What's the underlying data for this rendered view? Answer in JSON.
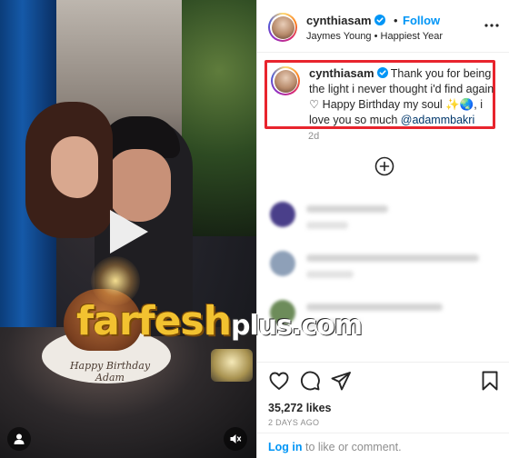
{
  "media": {
    "plate_text": "Happy Birthday Adam",
    "icons": [
      "play-icon",
      "person-tag-icon",
      "mute-icon"
    ]
  },
  "header": {
    "username": "cynthiasam",
    "separator": "•",
    "follow_label": "Follow",
    "subtitle": "Jaymes Young • Happiest Year",
    "more_icon": "more-icon"
  },
  "caption": {
    "username": "cynthiasam",
    "text": "Thank you for being the light i never thought i'd find again ♡ Happy Birthday my soul ✨🌏, i love you so much",
    "mention": "@adammbakri",
    "age": "2d"
  },
  "blurred_comments": [
    {
      "avatar_color": "#4a3f8a"
    },
    {
      "avatar_color": "#8ea0b8"
    },
    {
      "avatar_color": "#6d8c5a"
    }
  ],
  "watermark": {
    "main": "farfesh",
    "suffix": "plus.com"
  },
  "actions": {
    "icons": [
      "heart-icon",
      "comment-icon",
      "share-icon",
      "bookmark-icon"
    ]
  },
  "likes": "35,272 likes",
  "posted_ago": "2 DAYS AGO",
  "login": {
    "link": "Log in",
    "rest": " to like or comment."
  },
  "colors": {
    "accent_blue": "#0095f6",
    "highlight_red": "#e8242d",
    "mention": "#00376b",
    "watermark_gold": "#f2c230"
  }
}
